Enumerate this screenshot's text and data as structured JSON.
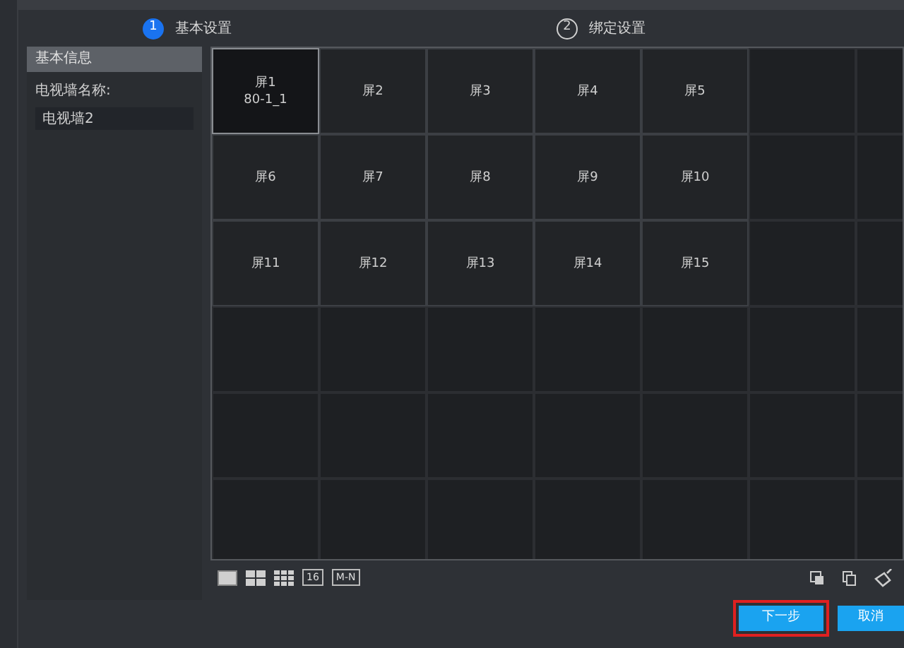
{
  "steps": [
    {
      "number": "1",
      "label": "基本设置",
      "selected": true
    },
    {
      "number": "2",
      "label": "绑定设置",
      "selected": false
    }
  ],
  "sidebar": {
    "header": "基本信息",
    "field_label": "电视墙名称:",
    "field_value": "电视墙2"
  },
  "screens": [
    {
      "label": "屏1",
      "sublabel": "80-1_1",
      "selected": true
    },
    {
      "label": "屏2",
      "selected": false
    },
    {
      "label": "屏3",
      "selected": false
    },
    {
      "label": "屏4",
      "selected": false
    },
    {
      "label": "屏5",
      "selected": false
    },
    {
      "label": "屏6",
      "selected": false
    },
    {
      "label": "屏7",
      "selected": false
    },
    {
      "label": "屏8",
      "selected": false
    },
    {
      "label": "屏9",
      "selected": false
    },
    {
      "label": "屏10",
      "selected": false
    },
    {
      "label": "屏11",
      "selected": false
    },
    {
      "label": "屏12",
      "selected": false
    },
    {
      "label": "屏13",
      "selected": false
    },
    {
      "label": "屏14",
      "selected": false
    },
    {
      "label": "屏15",
      "selected": false
    }
  ],
  "layout_tools": [
    {
      "kind": "single"
    },
    {
      "kind": "quad"
    },
    {
      "kind": "nine"
    },
    {
      "kind": "text",
      "label": "16"
    },
    {
      "kind": "text",
      "label": "M-N"
    }
  ],
  "buttons": [
    {
      "label": "下一步",
      "highlighted": true
    },
    {
      "label": "取消",
      "highlighted": false
    }
  ]
}
